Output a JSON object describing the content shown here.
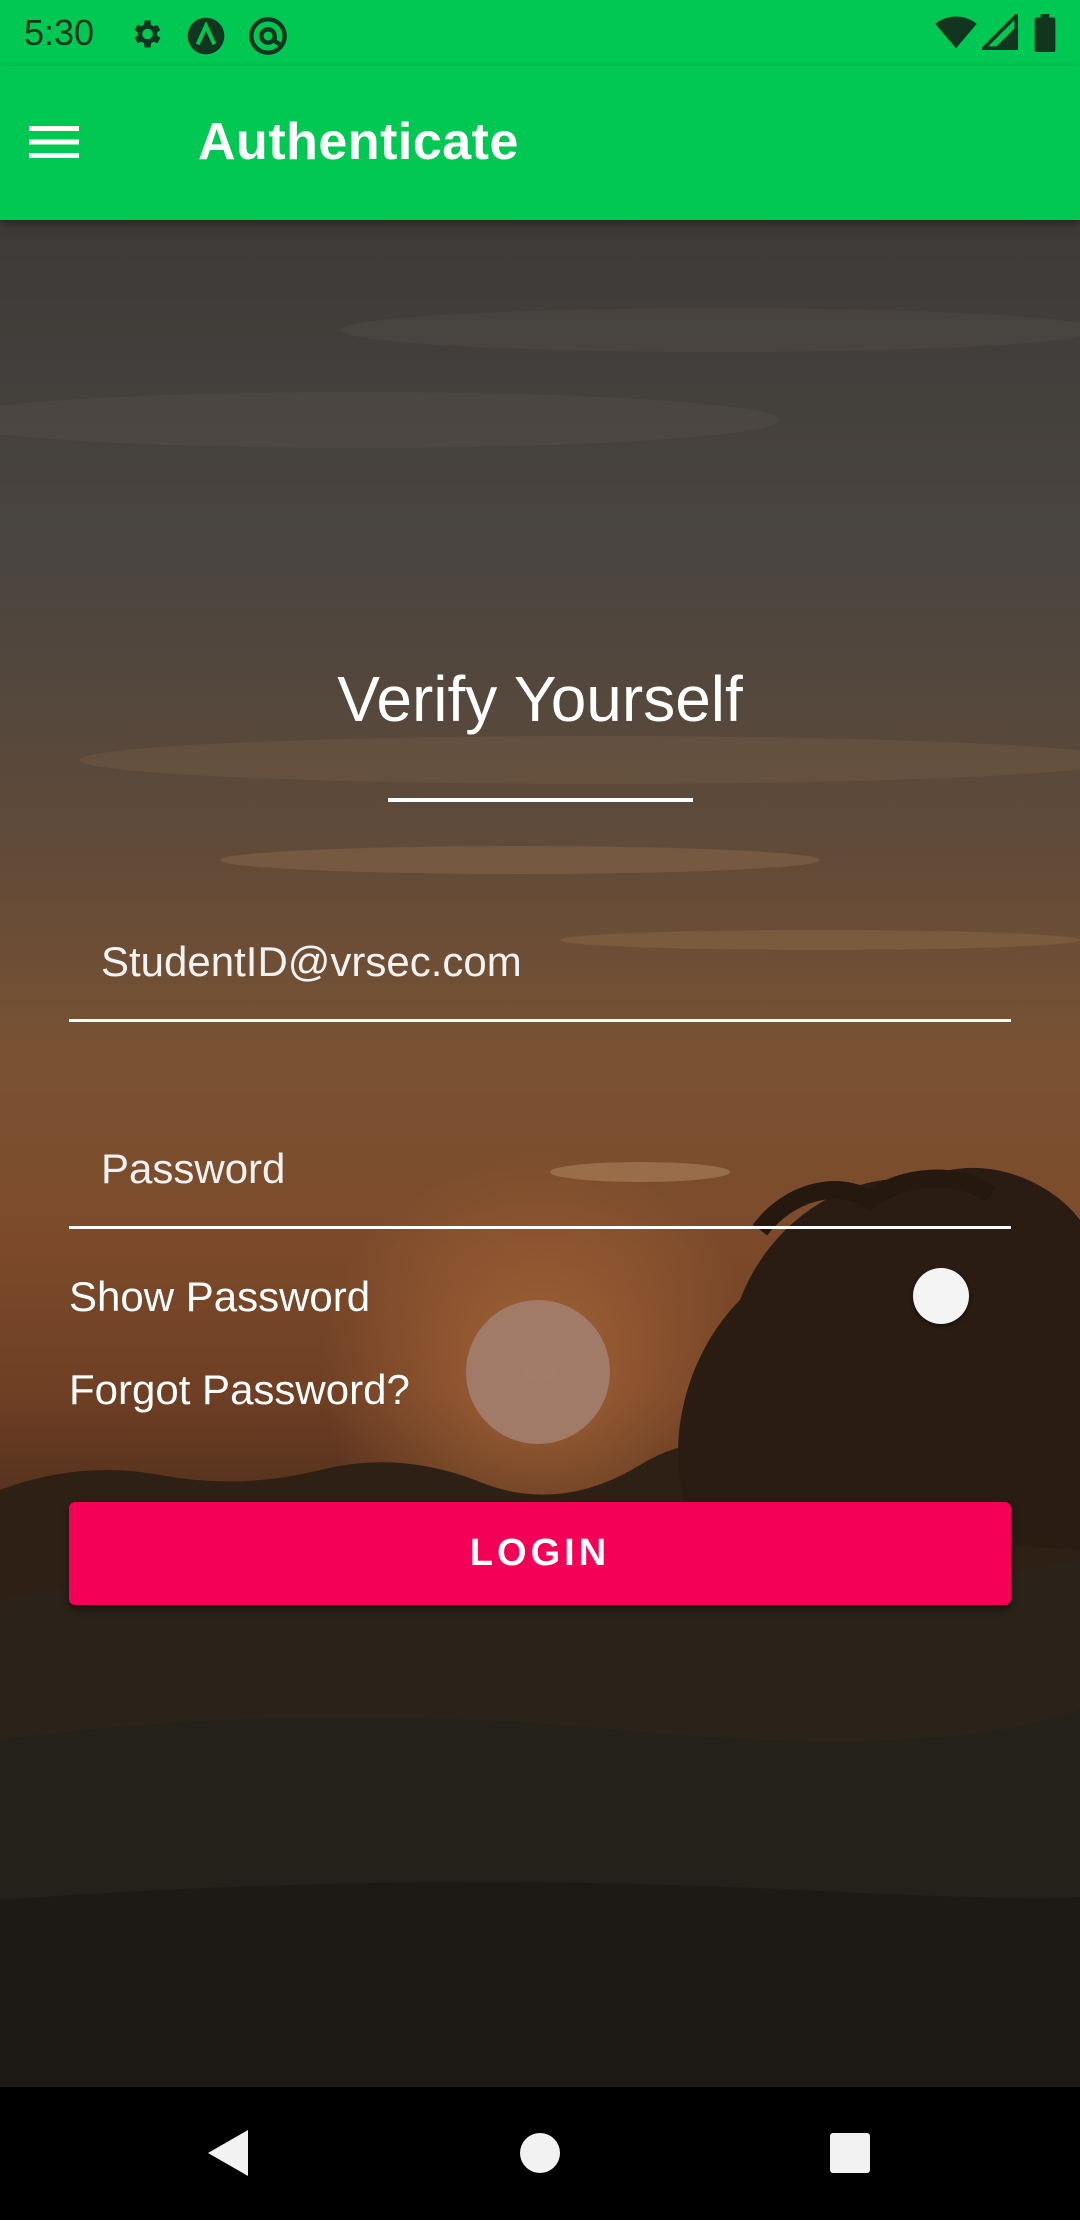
{
  "status_bar": {
    "time": "5:30",
    "left_icons": [
      "gear-icon",
      "a-logo-icon",
      "at-circle-icon"
    ],
    "right_icons": [
      "wifi-icon",
      "cell-signal-icon",
      "battery-icon"
    ]
  },
  "app_bar": {
    "title": "Authenticate",
    "menu_icon": "hamburger-menu-icon",
    "color": "#00c853"
  },
  "form": {
    "title": "Verify Yourself",
    "email_placeholder": "StudentID@vrsec.com",
    "email_value": "",
    "password_placeholder": "Password",
    "password_value": "",
    "show_password_label": "Show Password",
    "show_password_on": false,
    "forgot_password_label": "Forgot Password?",
    "login_label": "LOGIN",
    "login_color": "#f50057"
  },
  "nav_bar": {
    "buttons": [
      "back-icon",
      "home-icon",
      "recents-icon"
    ]
  }
}
